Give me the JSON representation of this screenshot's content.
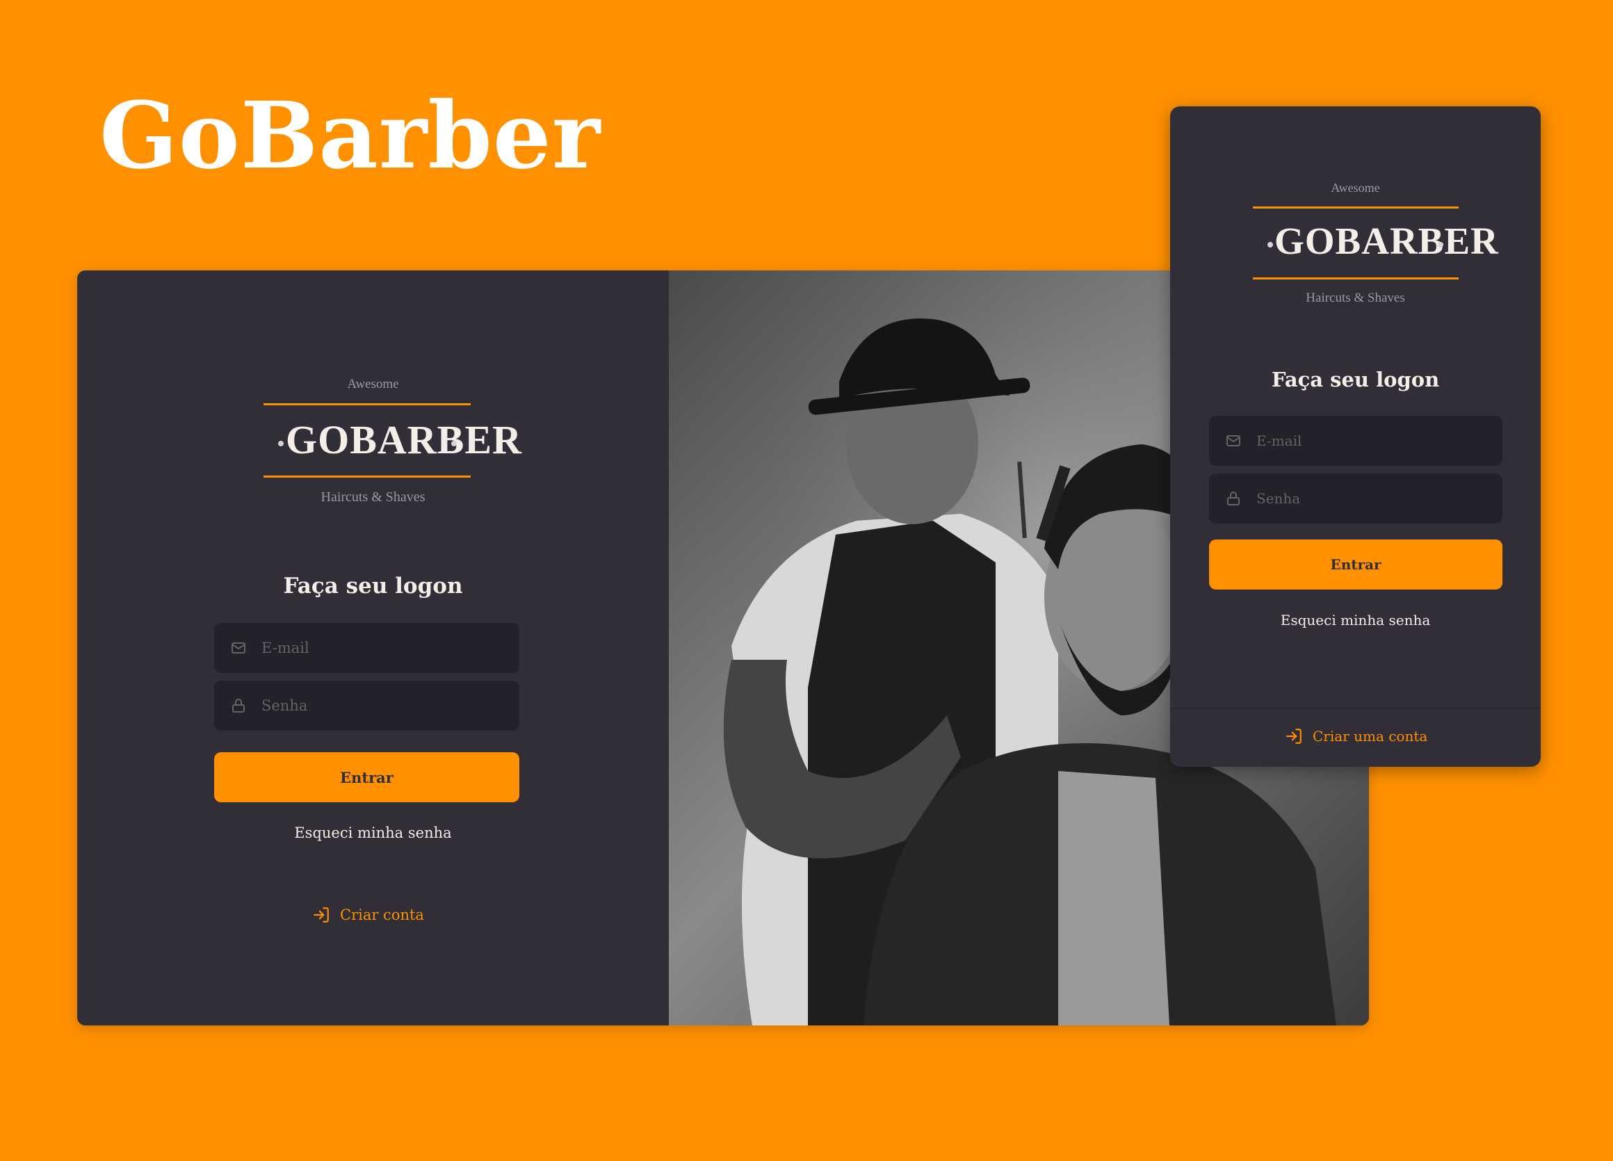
{
  "brand": {
    "title": "GoBarber"
  },
  "colors": {
    "background": "#FF9000",
    "panel": "#312e38",
    "input": "#232129",
    "accent": "#FF9000",
    "text": "#f4ede8",
    "placeholder": "#666360"
  },
  "desktop": {
    "logo": {
      "top": "Awesome",
      "main": "GoBarber",
      "bottom": "Haircuts & Shaves"
    },
    "heading": "Faça seu logon",
    "email": {
      "placeholder": "E-mail",
      "value": "",
      "icon": "mail-icon"
    },
    "password": {
      "placeholder": "Senha",
      "value": "",
      "icon": "lock-icon"
    },
    "submit_label": "Entrar",
    "forgot_label": "Esqueci minha senha",
    "create_label": "Criar conta",
    "create_icon": "log-in-icon",
    "photo": "barber-photo"
  },
  "mobile": {
    "logo": {
      "top": "Awesome",
      "main": "GoBarber",
      "bottom": "Haircuts & Shaves"
    },
    "heading": "Faça seu logon",
    "email": {
      "placeholder": "E-mail",
      "value": "",
      "icon": "mail-icon"
    },
    "password": {
      "placeholder": "Senha",
      "value": "",
      "icon": "lock-icon"
    },
    "submit_label": "Entrar",
    "forgot_label": "Esqueci minha senha",
    "create_label": "Criar uma conta",
    "create_icon": "log-in-icon"
  }
}
